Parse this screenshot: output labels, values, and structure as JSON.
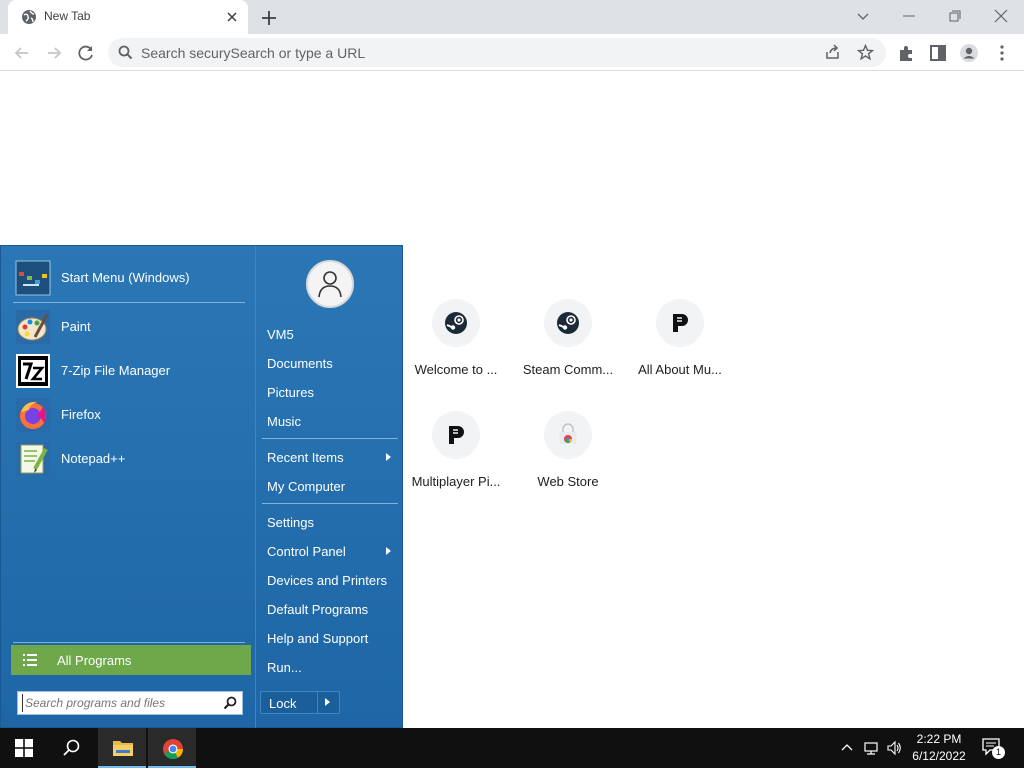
{
  "browser": {
    "tab_title": "New Tab",
    "omnibox_placeholder": "Search securySearch or type a URL"
  },
  "shortcuts": [
    {
      "label": "Welcome to ...",
      "icon": "steam-icon"
    },
    {
      "label": "Steam Comm...",
      "icon": "steam-icon"
    },
    {
      "label": "All About Mu...",
      "icon": "p-logo-icon"
    },
    {
      "label": "Multiplayer Pi...",
      "icon": "p-logo-icon"
    },
    {
      "label": "Web Store",
      "icon": "chrome-web-store-icon"
    }
  ],
  "start_menu": {
    "pinned": [
      {
        "label": "Start Menu (Windows)",
        "icon": "start-menu-icon"
      },
      {
        "label": "Paint",
        "icon": "paint-icon"
      },
      {
        "label": "7-Zip File Manager",
        "icon": "7zip-icon"
      },
      {
        "label": "Firefox",
        "icon": "firefox-icon"
      },
      {
        "label": "Notepad++",
        "icon": "notepadpp-icon"
      }
    ],
    "all_programs": "All Programs",
    "search_placeholder": "Search programs and files",
    "user": "VM5",
    "links": [
      {
        "label": "Documents"
      },
      {
        "label": "Pictures"
      },
      {
        "label": "Music"
      },
      {
        "label": "Recent Items",
        "submenu": true
      },
      {
        "label": "My Computer"
      },
      {
        "label": "Settings"
      },
      {
        "label": "Control Panel",
        "submenu": true
      },
      {
        "label": "Devices and Printers"
      },
      {
        "label": "Default Programs"
      },
      {
        "label": "Help and Support"
      },
      {
        "label": "Run..."
      }
    ],
    "lock_label": "Lock"
  },
  "taskbar": {
    "time": "2:22 PM",
    "date": "6/12/2022",
    "notification_count": "1"
  },
  "colors": {
    "start_menu_bg": "#2b77b5",
    "all_programs_bg": "#6fa84a",
    "taskbar_bg": "#101010"
  }
}
